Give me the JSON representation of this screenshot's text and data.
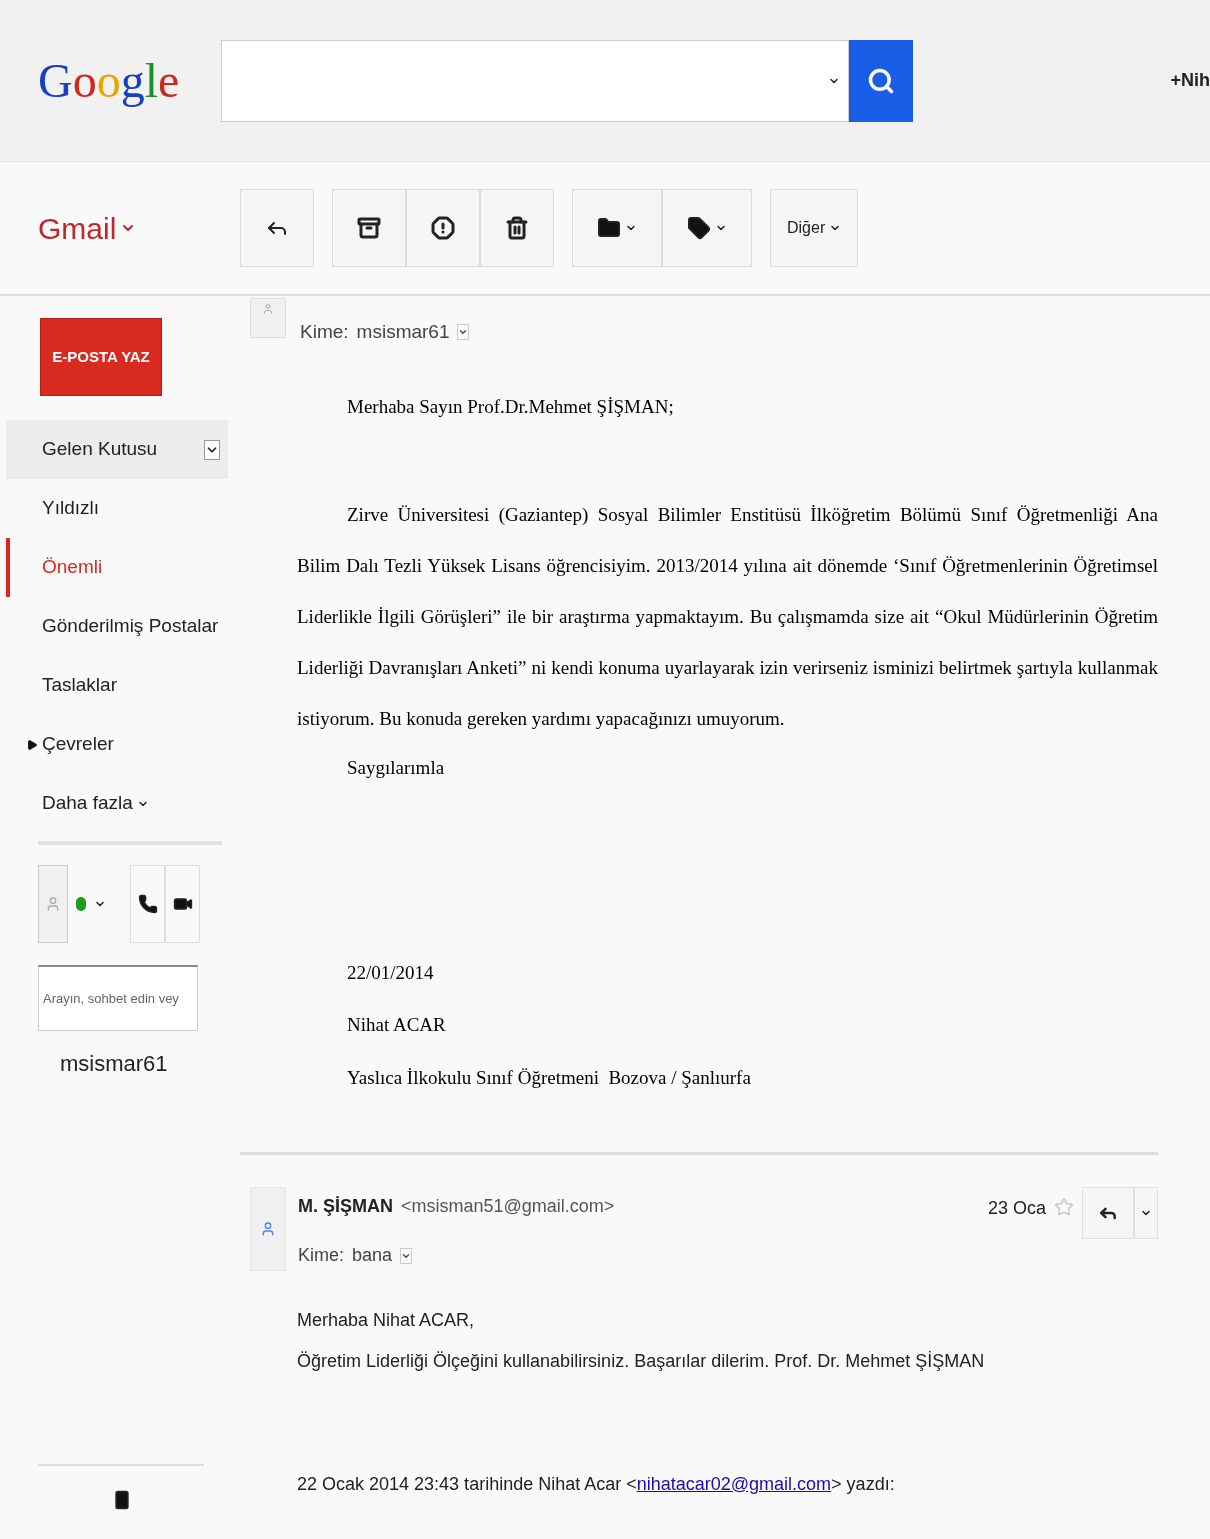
{
  "header": {
    "logo": "Google",
    "account": "+Nih"
  },
  "toolbar": {
    "app_menu": "Gmail",
    "more_button": "Diğer"
  },
  "sidebar": {
    "compose": "E-POSTA YAZ",
    "items": [
      {
        "kind": "folder",
        "label": "Gelen Kutusu",
        "selected": false,
        "hovered": true
      },
      {
        "kind": "folder",
        "label": "Yıldızlı",
        "selected": false,
        "hovered": false
      },
      {
        "kind": "folder",
        "label": "Önemli",
        "selected": true,
        "hovered": false
      },
      {
        "kind": "folder",
        "label": "Gönderilmiş Postalar",
        "selected": false,
        "hovered": false
      },
      {
        "kind": "folder",
        "label": "Taslaklar",
        "selected": false,
        "hovered": false
      },
      {
        "kind": "group",
        "label": "Çevreler",
        "selected": false,
        "hovered": false,
        "expanded": false
      },
      {
        "kind": "more",
        "label": "Daha fazla",
        "selected": false,
        "hovered": false
      }
    ]
  },
  "chat": {
    "search": {
      "placeholder": "Arayın, sohbet edin vey"
    },
    "contacts": [
      "msismar61"
    ]
  },
  "first_message": {
    "to_label": "Kime:",
    "to": "msismar61",
    "greeting": "Merhaba Sayın Prof.Dr.Mehmet ŞİŞMAN;",
    "paragraph": "Zirve Üniversitesi (Gaziantep) Sosyal Bilimler Enstitüsü İlköğretim Bölümü Sınıf Öğretmenliği Ana Bilim Dalı Tezli Yüksek Lisans öğrencisiyim. 2013/2014 yılına ait dönemde ‘Sınıf Öğretmenlerinin Öğretimsel Liderlikle İlgili Görüşleri” ile bir araştırma yapmaktayım. Bu çalışmamda size ait “Okul Müdürlerinin Öğretim Liderliği Davranışları Anketi” ni kendi konuma uyarlayarak izin verirseniz isminizi belirtmek şartıyla kullanmak istiyorum. Bu konuda gereken yardımı yapacağınızı umuyorum.",
    "closing": "Saygılarımla",
    "signature": [
      "22/01/2014",
      "Nihat ACAR",
      "Yaslıca İlkokulu Sınıf Öğretmeni  Bozova / Şanlıurfa"
    ]
  },
  "second_message": {
    "sender": "M. ŞİŞMAN",
    "sender_email": "<msisman51@gmail.com>",
    "to_label": "Kime:",
    "to": "bana",
    "date": "23 Oca",
    "starred": false,
    "body": [
      "Merhaba Nihat ACAR,",
      "Öğretim Liderliği Ölçeğini kullanabilirsiniz. Başarılar dilerim. Prof. Dr. Mehmet ŞİŞMAN"
    ],
    "quote_prefix": "22 Ocak 2014 23:43 tarihinde Nihat Acar <",
    "quote_link": "nihatacar02@gmail.com",
    "quote_suffix": "> yazdı:"
  }
}
